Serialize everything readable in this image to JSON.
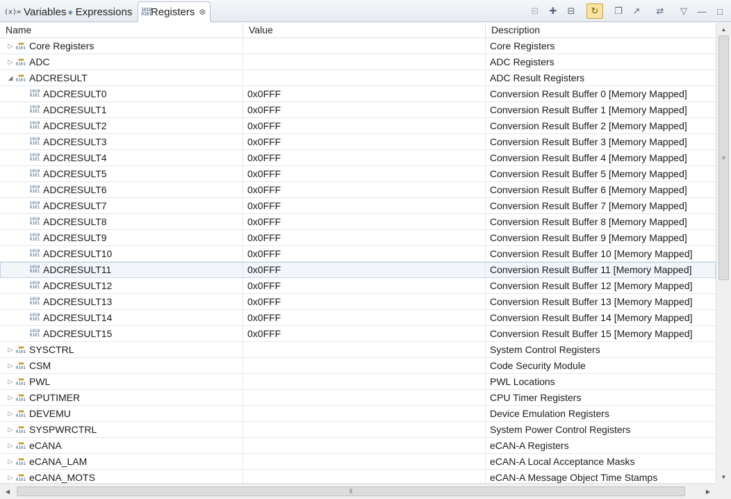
{
  "tabs": [
    {
      "label": "Variables",
      "icon": "variables-icon",
      "icon_glyph": "(x)="
    },
    {
      "label": "Expressions",
      "icon": "expressions-icon",
      "icon_glyph": "6"
    },
    {
      "label": "Registers",
      "icon": "registers-icon",
      "icon_glyph": "1010"
    }
  ],
  "toolbar_icons": [
    "collapse-all-icon",
    "new-register-group-icon",
    "remove-icon",
    "enable-polling-icon",
    "new-expression-icon",
    "export-icon",
    "refresh-icon",
    "view-menu-icon",
    "minimize-icon",
    "maximize-icon"
  ],
  "columns": {
    "name": "Name",
    "value": "Value",
    "description": "Description"
  },
  "rows": [
    {
      "name": "Core Registers",
      "value": "",
      "description": "Core Registers",
      "kind": "group",
      "expanded": false
    },
    {
      "name": "ADC",
      "value": "",
      "description": "ADC Registers",
      "kind": "group",
      "expanded": false
    },
    {
      "name": "ADCRESULT",
      "value": "",
      "description": "ADC Result Registers",
      "kind": "group",
      "expanded": true
    },
    {
      "name": "ADCRESULT0",
      "value": "0x0FFF",
      "description": "Conversion Result Buffer 0 [Memory Mapped]",
      "kind": "register"
    },
    {
      "name": "ADCRESULT1",
      "value": "0x0FFF",
      "description": "Conversion Result Buffer 1 [Memory Mapped]",
      "kind": "register"
    },
    {
      "name": "ADCRESULT2",
      "value": "0x0FFF",
      "description": "Conversion Result Buffer 2 [Memory Mapped]",
      "kind": "register"
    },
    {
      "name": "ADCRESULT3",
      "value": "0x0FFF",
      "description": "Conversion Result Buffer 3 [Memory Mapped]",
      "kind": "register"
    },
    {
      "name": "ADCRESULT4",
      "value": "0x0FFF",
      "description": "Conversion Result Buffer 4 [Memory Mapped]",
      "kind": "register"
    },
    {
      "name": "ADCRESULT5",
      "value": "0x0FFF",
      "description": "Conversion Result Buffer 5 [Memory Mapped]",
      "kind": "register"
    },
    {
      "name": "ADCRESULT6",
      "value": "0x0FFF",
      "description": "Conversion Result Buffer 6 [Memory Mapped]",
      "kind": "register"
    },
    {
      "name": "ADCRESULT7",
      "value": "0x0FFF",
      "description": "Conversion Result Buffer 7 [Memory Mapped]",
      "kind": "register"
    },
    {
      "name": "ADCRESULT8",
      "value": "0x0FFF",
      "description": "Conversion Result Buffer 8 [Memory Mapped]",
      "kind": "register"
    },
    {
      "name": "ADCRESULT9",
      "value": "0x0FFF",
      "description": "Conversion Result Buffer 9 [Memory Mapped]",
      "kind": "register"
    },
    {
      "name": "ADCRESULT10",
      "value": "0x0FFF",
      "description": "Conversion Result Buffer 10 [Memory Mapped]",
      "kind": "register"
    },
    {
      "name": "ADCRESULT11",
      "value": "0x0FFF",
      "description": "Conversion Result Buffer 11 [Memory Mapped]",
      "kind": "register",
      "selected": true
    },
    {
      "name": "ADCRESULT12",
      "value": "0x0FFF",
      "description": "Conversion Result Buffer 12 [Memory Mapped]",
      "kind": "register"
    },
    {
      "name": "ADCRESULT13",
      "value": "0x0FFF",
      "description": "Conversion Result Buffer 13 [Memory Mapped]",
      "kind": "register"
    },
    {
      "name": "ADCRESULT14",
      "value": "0x0FFF",
      "description": "Conversion Result Buffer 14 [Memory Mapped]",
      "kind": "register"
    },
    {
      "name": "ADCRESULT15",
      "value": "0x0FFF",
      "description": "Conversion Result Buffer 15 [Memory Mapped]",
      "kind": "register"
    },
    {
      "name": "SYSCTRL",
      "value": "",
      "description": "System Control Registers",
      "kind": "group",
      "expanded": false
    },
    {
      "name": "CSM",
      "value": "",
      "description": "Code Security Module",
      "kind": "group",
      "expanded": false
    },
    {
      "name": "PWL",
      "value": "",
      "description": "PWL Locations",
      "kind": "group",
      "expanded": false
    },
    {
      "name": "CPUTIMER",
      "value": "",
      "description": "CPU Timer Registers",
      "kind": "group",
      "expanded": false
    },
    {
      "name": "DEVEMU",
      "value": "",
      "description": "Device Emulation Registers",
      "kind": "group",
      "expanded": false
    },
    {
      "name": "SYSPWRCTRL",
      "value": "",
      "description": "System Power Control Registers",
      "kind": "group",
      "expanded": false
    },
    {
      "name": "eCANA",
      "value": "",
      "description": "eCAN-A  Registers",
      "kind": "group",
      "expanded": false
    },
    {
      "name": "eCANA_LAM",
      "value": "",
      "description": "eCAN-A Local Acceptance Masks",
      "kind": "group",
      "expanded": false
    },
    {
      "name": "eCANA_MOTS",
      "value": "",
      "description": "eCAN-A Message Object Time Stamps",
      "kind": "group",
      "expanded": false
    }
  ]
}
